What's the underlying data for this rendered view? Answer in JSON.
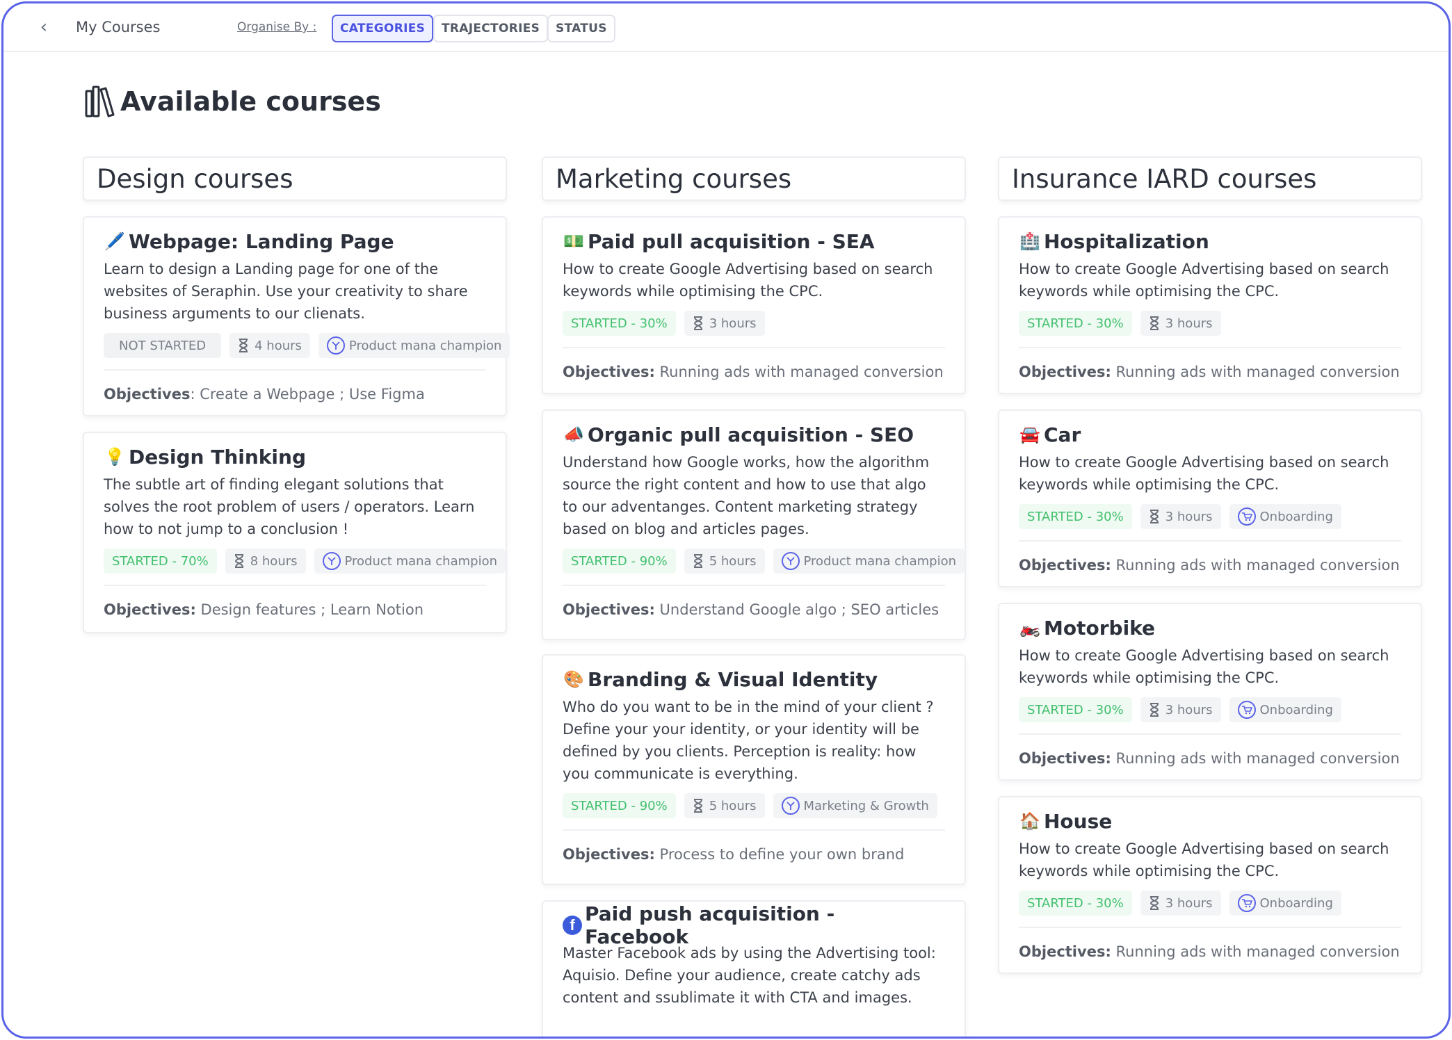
{
  "topbar": {
    "title": "My Courses",
    "organise_label": "Organise By :",
    "options": [
      "CATEGORIES",
      "TRAJECTORIES",
      "STATUS"
    ],
    "active": "CATEGORIES"
  },
  "section": {
    "title": "Available courses"
  },
  "columns": [
    {
      "title": "Design courses",
      "cards": [
        {
          "icon": "pencil-icon",
          "emoji": "🖊️",
          "title": "Webpage: Landing Page",
          "description": "Learn to design a Landing page for one of the websites of Seraphin. Use your creativity to share business arguments to our clienats.",
          "status": "NOT STARTED",
          "duration": "4 hours",
          "trajectory": "Product mana champion",
          "objectives_label": "Objectives",
          "objectives": ": Create a Webpage ; Use Figma"
        },
        {
          "icon": "lightbulb-icon",
          "emoji": "💡",
          "title": "Design Thinking",
          "description": "The subtle art of finding elegant solutions that solves the root problem of users / operators. Learn how to not jump to a conclusion !",
          "status": "STARTED - 70%",
          "duration": "8 hours",
          "trajectory": "Product mana champion",
          "objectives_label": "Objectives:",
          "objectives": " Design features ; Learn Notion"
        }
      ]
    },
    {
      "title": "Marketing courses",
      "cards": [
        {
          "icon": "money-icon",
          "emoji": "💵",
          "title": "Paid pull acquisition - SEA",
          "description": "How to create Google Advertising based on search keywords while optimising the CPC.",
          "status": "STARTED - 30%",
          "duration": "3 hours",
          "trajectory": "",
          "objectives_label": "Objectives:",
          "objectives": " Running ads with managed conversion"
        },
        {
          "icon": "megaphone-icon",
          "emoji": "📣",
          "title": "Organic pull acquisition - SEO",
          "description": "Understand how Google works, how the algorithm source the right content and how to use that algo to our adventanges. Content marketing strategy based on blog and articles pages.",
          "status": "STARTED - 90%",
          "duration": "5 hours",
          "trajectory": "Product mana champion",
          "objectives_label": "Objectives:",
          "objectives": " Understand Google algo ; SEO articles"
        },
        {
          "icon": "palette-icon",
          "emoji": "🎨",
          "title": "Branding & Visual Identity",
          "description": "Who do you want to be in the mind of your client ? Define your your identity, or your identity will be defined by you clients. Perception is reality: how you communicate is everything.",
          "status": "STARTED - 90%",
          "duration": "5 hours",
          "trajectory": "Marketing & Growth",
          "objectives_label": "Objectives:",
          "objectives": " Process to define your own brand"
        },
        {
          "icon": "facebook-icon",
          "emoji": "f",
          "title": "Paid push acquisition - Facebook",
          "description": "Master Facebook ads by using the Advertising tool: Aquisio. Define your audience, create catchy ads content and ssublimate it with CTA and images.",
          "status": "",
          "duration": "",
          "trajectory": "",
          "objectives_label": "",
          "objectives": ""
        }
      ]
    },
    {
      "title": "Insurance IARD courses",
      "cards": [
        {
          "icon": "hospital-icon",
          "emoji": "🏥",
          "title": "Hospitalization",
          "description": "How to create Google Advertising based on search keywords while optimising the CPC.",
          "status": "STARTED - 30%",
          "duration": "3 hours",
          "trajectory": "",
          "objectives_label": "Objectives:",
          "objectives": " Running ads with managed conversion"
        },
        {
          "icon": "car-icon",
          "emoji": "🚘",
          "title": "Car",
          "description": "How to create Google Advertising based on search keywords while optimising the CPC.",
          "status": "STARTED - 30%",
          "duration": "3 hours",
          "trajectory": "Onboarding",
          "objectives_label": "Objectives:",
          "objectives": " Running ads with managed conversion"
        },
        {
          "icon": "motorbike-icon",
          "emoji": "🏍️",
          "title": "Motorbike",
          "description": "How to create Google Advertising based on search keywords while optimising the CPC.",
          "status": "STARTED - 30%",
          "duration": "3 hours",
          "trajectory": "Onboarding",
          "objectives_label": "Objectives:",
          "objectives": " Running ads with managed conversion"
        },
        {
          "icon": "house-icon",
          "emoji": "🏠",
          "title": "House",
          "description": "How to create Google Advertising based on search keywords while optimising the CPC.",
          "status": "STARTED - 30%",
          "duration": "3 hours",
          "trajectory": "Onboarding",
          "objectives_label": "Objectives:",
          "objectives": " Running ads with managed conversion"
        }
      ]
    }
  ],
  "colors": {
    "accent": "#5b63e8",
    "started": "#43c06e",
    "frame": "#5b63e8"
  }
}
